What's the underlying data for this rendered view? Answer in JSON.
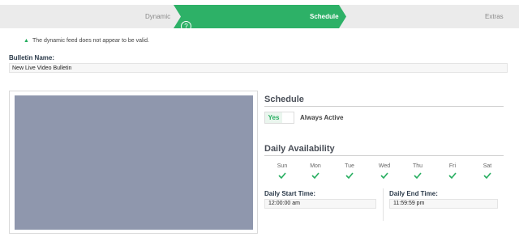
{
  "wizard": {
    "steps": [
      {
        "label": "Dynamic",
        "state": "inactive"
      },
      {
        "label": "Schedule",
        "state": "active"
      },
      {
        "label": "Extras",
        "state": "inactive"
      }
    ],
    "help_glyph": "?",
    "active_color": "#2db167",
    "inactive_color": "#ebebeb"
  },
  "warning": {
    "icon": "warning-triangle-icon",
    "text": "The dynamic feed does not appear to be valid."
  },
  "bulletin": {
    "label": "Bulletin Name:",
    "value": "New Live Video Bulletin"
  },
  "preview": {
    "placeholder_color": "#8f97ad"
  },
  "schedule": {
    "title": "Schedule",
    "toggle_label": "Yes",
    "always_active_label": "Always Active"
  },
  "availability": {
    "title": "Daily Availability",
    "days": [
      {
        "name": "Sun",
        "checked": true
      },
      {
        "name": "Mon",
        "checked": true
      },
      {
        "name": "Tue",
        "checked": true
      },
      {
        "name": "Wed",
        "checked": true
      },
      {
        "name": "Thu",
        "checked": true
      },
      {
        "name": "Fri",
        "checked": true
      },
      {
        "name": "Sat",
        "checked": true
      }
    ],
    "start_label": "Daily Start Time:",
    "start_value": "12:00:00 am",
    "end_label": "Daily End Time:",
    "end_value": "11:59:59 pm"
  }
}
